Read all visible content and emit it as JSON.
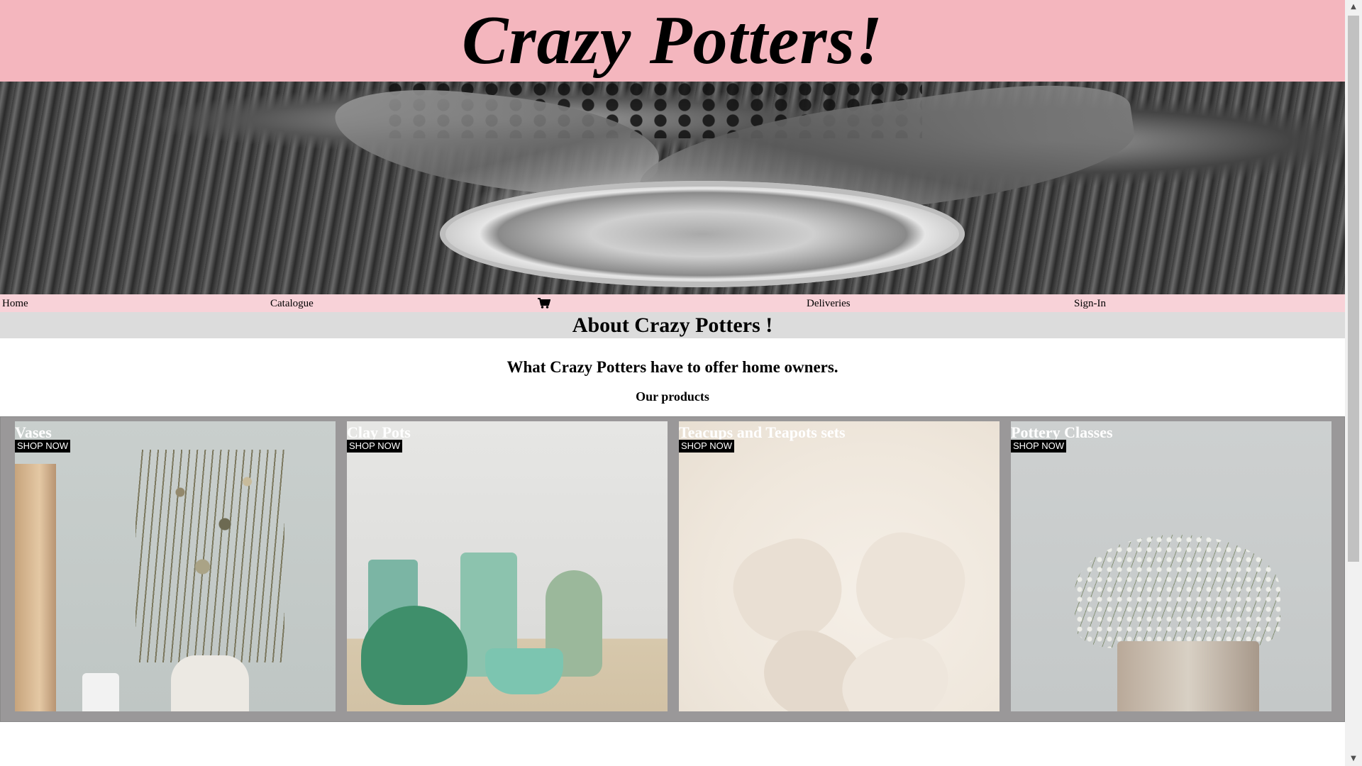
{
  "header": {
    "title": "Crazy Potters!"
  },
  "nav": {
    "items": [
      {
        "label": "Home"
      },
      {
        "label": "Catalogue"
      },
      {
        "icon": "shopping-cart-icon"
      },
      {
        "label": "Deliveries"
      },
      {
        "label": "Sign-In"
      }
    ]
  },
  "about": {
    "title": "About Crazy Potters !",
    "subheading": "What Crazy Potters have to offer home owners.",
    "products_label": "Our products"
  },
  "products": [
    {
      "title": "Vases",
      "button": "SHOP NOW"
    },
    {
      "title": "Clay Pots",
      "button": "SHOP NOW"
    },
    {
      "title": "Teacups and Teapots sets",
      "button": "SHOP NOW"
    },
    {
      "title": "Pottery Classes",
      "button": "SHOP NOW"
    }
  ],
  "colors": {
    "header_bg": "#f4b6be",
    "nav_bg": "#f8d2d8",
    "about_bg": "#dcdcdc",
    "gallery_bg": "#9a9899"
  }
}
